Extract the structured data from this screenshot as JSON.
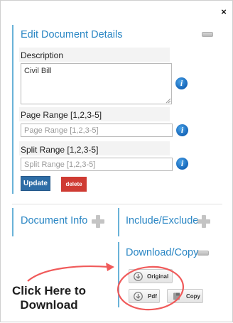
{
  "dialog": {
    "close_symbol": "×"
  },
  "edit_section": {
    "title": "Edit Document Details",
    "description_label": "Description",
    "description_value": "Civil Bill",
    "page_range_label": "Page Range [1,2,3-5]",
    "page_range_placeholder": "Page Range [1,2,3-5]",
    "split_range_label": "Split Range [1,2,3-5]",
    "split_range_placeholder": "Split Range [1,2,3-5]",
    "update_label": "Update",
    "delete_label": "delete",
    "info_symbol": "i"
  },
  "sections": {
    "document_info": "Document Info",
    "include_exclude": "Include/Exclude",
    "download_copy": "Download/Copy"
  },
  "download_buttons": {
    "original": "Original",
    "pdf": "Pdf",
    "copy": "Copy"
  },
  "annotation": {
    "line1": "Click Here to",
    "line2": "Download"
  },
  "colors": {
    "accent_blue": "#2a86c4",
    "panel_border": "#6ab2d8",
    "update_button": "#2e6da6",
    "delete_button": "#cf3b33",
    "annotation_red": "#f05a5a"
  },
  "icons": {
    "close": "close-icon",
    "info": "info-icon",
    "collapse": "minus-icon",
    "expand": "plus-icon",
    "download": "download-icon",
    "copy": "copy-icon"
  }
}
